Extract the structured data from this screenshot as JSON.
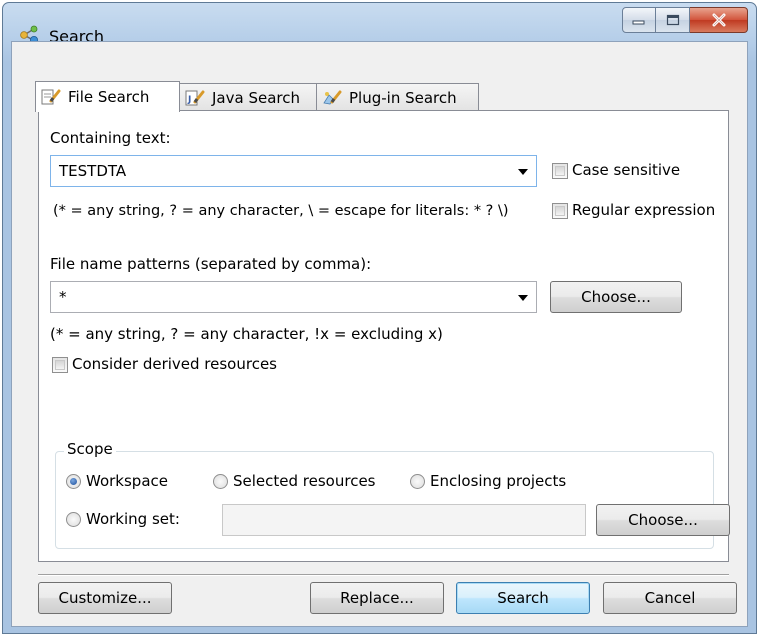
{
  "window": {
    "title": "Search",
    "title_icon": "search-share-icon",
    "minimize_icon": "minimize-icon",
    "maximize_icon": "maximize-icon",
    "close_icon": "close-icon"
  },
  "tabs": [
    {
      "label": "File Search",
      "icon": "file-search-icon",
      "active": true
    },
    {
      "label": "Java Search",
      "icon": "java-search-icon",
      "active": false
    },
    {
      "label": "Plug-in Search",
      "icon": "plugin-search-icon",
      "active": false
    }
  ],
  "containing_text": {
    "label": "Containing text:",
    "value": "TESTDTA",
    "hint": "(* = any string, ? = any character, \\ = escape for literals: * ? \\)",
    "case_sensitive_label": "Case sensitive",
    "case_sensitive_checked": false,
    "regex_label": "Regular expression",
    "regex_checked": false
  },
  "file_patterns": {
    "label": "File name patterns (separated by comma):",
    "value": "*",
    "choose_label": "Choose...",
    "hint": "(* = any string, ? = any character, !x = excluding x)"
  },
  "derived": {
    "label": "Consider derived resources",
    "checked": false
  },
  "scope": {
    "title": "Scope",
    "workspace_label": "Workspace",
    "selected_resources_label": "Selected resources",
    "enclosing_projects_label": "Enclosing projects",
    "working_set_label": "Working set:",
    "working_set_value": "",
    "choose_label": "Choose...",
    "selected": "Workspace"
  },
  "footer": {
    "customize_label": "Customize...",
    "replace_label": "Replace...",
    "search_label": "Search",
    "cancel_label": "Cancel"
  },
  "colors": {
    "accent": "#3c7fb1",
    "title_gradient": "#b4cde8",
    "close_button": "#c03a22"
  }
}
